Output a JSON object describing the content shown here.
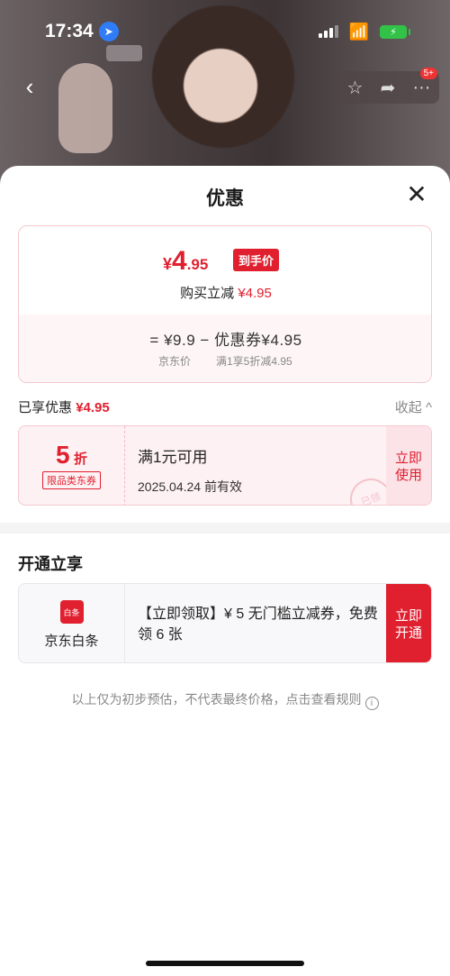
{
  "status_bar": {
    "time": "17:34",
    "location_icon": "location-arrow-icon",
    "battery_icon": "battery-charging-icon"
  },
  "nav": {
    "back_icon": "chevron-left-icon",
    "star_icon": "star-icon",
    "share_icon": "share-icon",
    "more_icon": "more-icon",
    "more_badge": "5+"
  },
  "sheet": {
    "title": "优惠",
    "close_icon": "close-icon"
  },
  "price_card": {
    "currency": "¥",
    "final_int": "4",
    "final_dec": ".95",
    "final_tag": "到手价",
    "buy_reduce_label": "购买立减",
    "buy_reduce_value": "¥4.95",
    "formula": "=  ¥9.9  −  优惠券¥4.95",
    "jd_price_label": "京东价",
    "coupon_rule": "满1享5折减4.95"
  },
  "enjoyed": {
    "label": "已享优惠",
    "value": "¥4.95",
    "collapse_label": "收起 ^"
  },
  "coupon": {
    "discount": "5",
    "discount_unit": "折",
    "category": "限品类东券",
    "condition": "满1元可用",
    "validity": "2025.04.24 前有效",
    "use_label": "立即使用",
    "stamp": "已领"
  },
  "open_section": {
    "title": "开通立享",
    "logo_text": "白条",
    "name": "京东白条",
    "promo": "【立即领取】¥ 5 无门槛立减券，免费领 6 张",
    "button_label": "立即开通"
  },
  "disclaimer": "以上仅为初步预估，不代表最终价格，点击查看规则",
  "colors": {
    "accent": "#e0202f",
    "card_bg": "#fdf1f3"
  }
}
